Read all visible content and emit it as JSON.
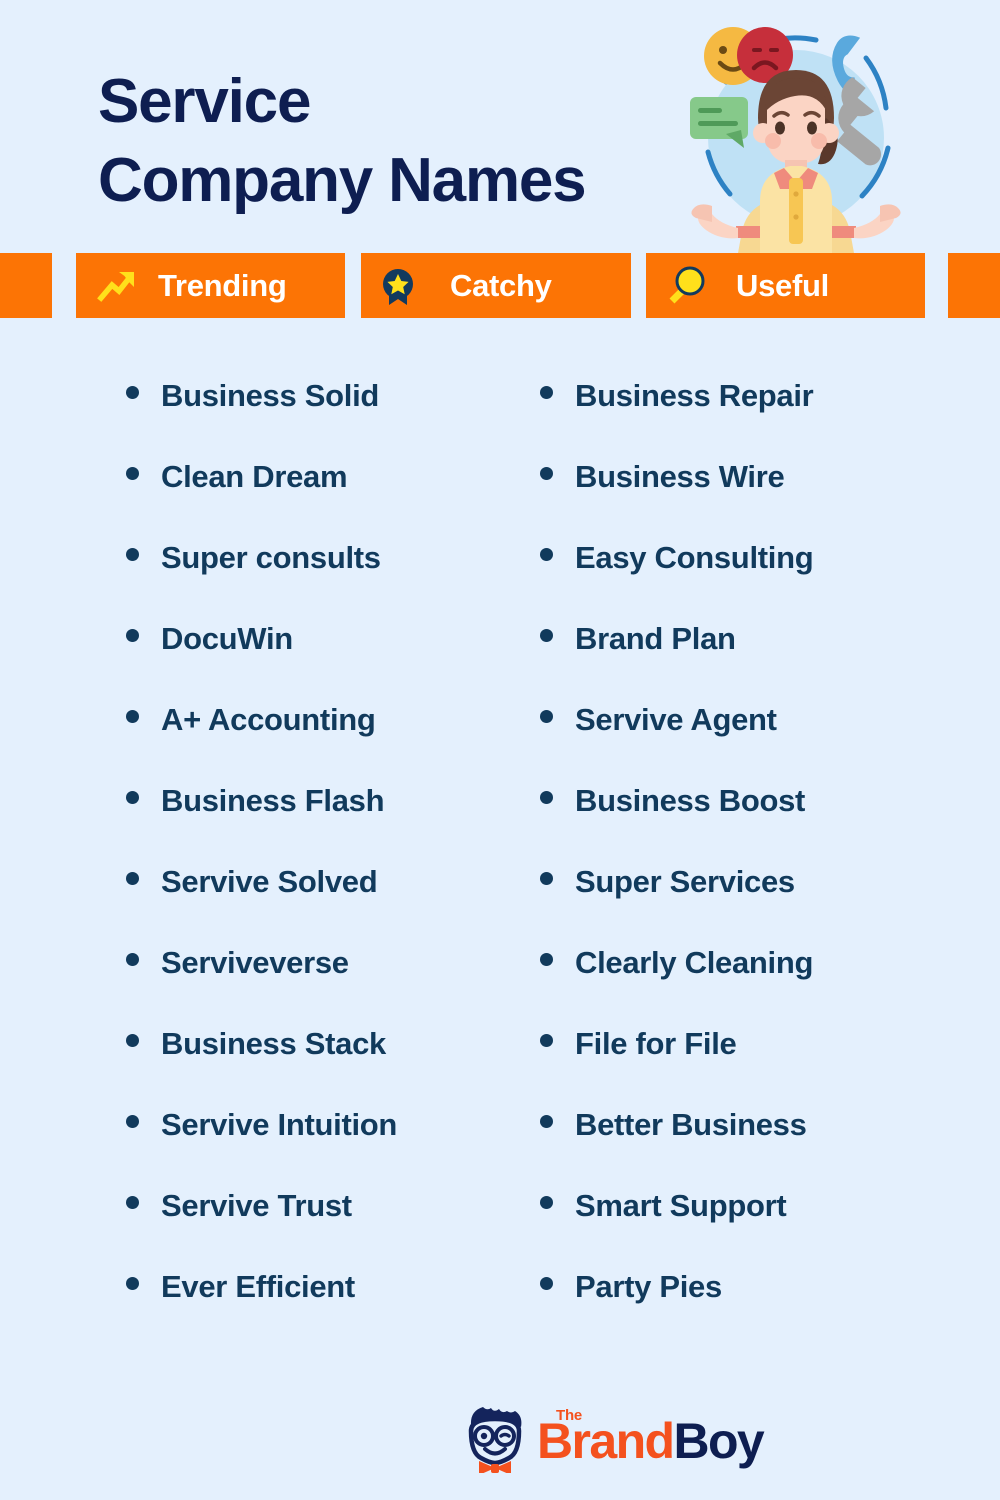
{
  "page": {
    "background_color": "#e4f0fd",
    "title": "Service\nCompany Names",
    "title_color": "#0e1e51"
  },
  "hero": {
    "icon_name": "customer-service-woman-illustration",
    "colors": {
      "circle": "#bfe1f5",
      "hair": "#6b4535",
      "skin": "#fbd4c4",
      "shirt": "#fbe3a4",
      "collar": "#ef8b7d",
      "chat_bubble": "#86c98a",
      "phone": "#5aa9dd",
      "wrench": "#a6a6a6",
      "smiley_happy": "#f5b942",
      "smiley_sad": "#c62f3b"
    }
  },
  "badge_bar": {
    "background_color": "#fc7405",
    "label_color": "#ffffff",
    "badges": [
      {
        "id": "trending",
        "label": "Trending",
        "icon_name": "trending-up-arrow-icon",
        "icon_color": "#ffe01b"
      },
      {
        "id": "catchy",
        "label": "Catchy",
        "icon_name": "award-ribbon-star-icon",
        "icon_color": "#ffe01b"
      },
      {
        "id": "useful",
        "label": "Useful",
        "icon_name": "magnifying-glass-icon",
        "icon_color": "#ffe01b"
      }
    ]
  },
  "names": {
    "text_color": "#113a5c",
    "bullet_color": "#113a5c",
    "column_1": [
      "Business Solid",
      "Clean Dream",
      "Super consults",
      "DocuWin",
      "A+ Accounting",
      "Business Flash",
      "Servive Solved",
      "Serviveverse",
      "Business Stack",
      "Servive Intuition",
      "Servive Trust",
      "Ever Efficient"
    ],
    "column_2": [
      "Business Repair",
      "Business Wire",
      "Easy Consulting",
      "Brand Plan",
      "Servive Agent",
      "Business Boost",
      "Super Services",
      "Clearly Cleaning",
      "File for File",
      "Better Business",
      "Smart Support",
      "Party Pies"
    ]
  },
  "footer": {
    "logo_icon_name": "brandboy-boy-face-logo",
    "the": "The",
    "brand": "Brand",
    "boy": "Boy",
    "brand_color": "#f4511e",
    "boy_color": "#0e1e51"
  }
}
